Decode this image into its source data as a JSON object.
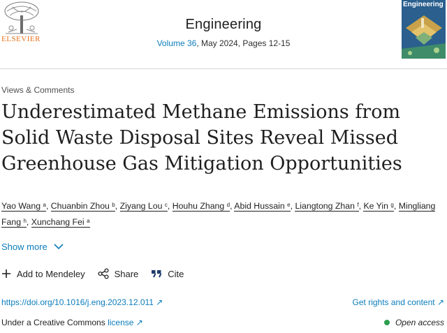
{
  "header": {
    "publisher": "ELSEVIER",
    "journal_title": "Engineering",
    "volume_link": "Volume 36",
    "issue_info": ", May 2024, Pages 12-15",
    "cover_title": "Engineering"
  },
  "article": {
    "type": "Views & Comments",
    "title": "Underestimated Methane Emissions from Solid Waste Disposal Sites Reveal Missed Greenhouse Gas Mitigation Opportunities",
    "authors": [
      {
        "name": "Yao Wang",
        "sup": "a",
        "sep": ","
      },
      {
        "name": "Chuanbin Zhou",
        "sup": "b",
        "sep": ","
      },
      {
        "name": "Ziyang Lou",
        "sup": "c",
        "sep": ","
      },
      {
        "name": "Houhu Zhang",
        "sup": "d",
        "sep": ","
      },
      {
        "name": "Abid Hussain",
        "sup": "e",
        "sep": ","
      },
      {
        "name": "Liangtong Zhan",
        "sup": "f",
        "sep": ","
      },
      {
        "name": "Ke Yin",
        "sup": "g",
        "sep": ","
      },
      {
        "name": "Mingliang Fang",
        "sup": "h",
        "sep": ","
      },
      {
        "name": "Xunchang Fei",
        "sup": "a",
        "sep": ""
      }
    ],
    "show_more": "Show more"
  },
  "actions": {
    "mendeley": "Add to Mendeley",
    "share": "Share",
    "cite": "Cite"
  },
  "links": {
    "doi": "https://doi.org/10.1016/j.eng.2023.12.011",
    "rights": "Get rights and content",
    "license_prefix": "Under a Creative Commons ",
    "license_link": "license",
    "open_access": "Open access"
  },
  "colors": {
    "link": "#0c7dbb",
    "publisher": "#e9711c",
    "open_access_dot": "#2e9e4f"
  }
}
